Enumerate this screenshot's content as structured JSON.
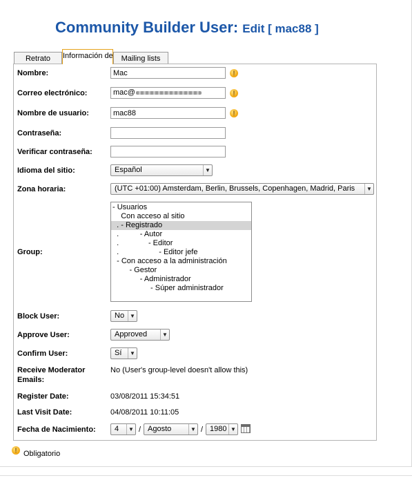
{
  "header": {
    "title": "Community Builder User:",
    "edit_label": "Edit [ mac88 ]"
  },
  "tabs": [
    {
      "label": "Retrato",
      "active": false
    },
    {
      "label": "Información de",
      "active": true
    },
    {
      "label": "Mailing lists",
      "active": false
    }
  ],
  "form": {
    "nombre_label": "Nombre:",
    "nombre_value": "Mac",
    "correo_label": "Correo electrónico:",
    "correo_value": "mac@",
    "usuario_label": "Nombre de usuario:",
    "usuario_value": "mac88",
    "contrasena_label": "Contraseña:",
    "verificar_label": "Verificar contraseña:",
    "idioma_label": "Idioma del sitio:",
    "idioma_value": "Español",
    "zona_label": "Zona horaria:",
    "zona_value": "(UTC +01:00) Amsterdam, Berlin, Brussels, Copenhagen, Madrid, Paris",
    "group_label": "Group:",
    "group_options": [
      {
        "text": "- Usuarios",
        "selected": false
      },
      {
        "text": "    Con acceso al sitio",
        "selected": false
      },
      {
        "text": "  . - Registrado",
        "selected": true
      },
      {
        "text": "  .          - Autor",
        "selected": false
      },
      {
        "text": "  .              - Editor",
        "selected": false
      },
      {
        "text": "  .                   - Editor jefe",
        "selected": false
      },
      {
        "text": "  - Con acceso a la administración",
        "selected": false
      },
      {
        "text": "        - Gestor",
        "selected": false
      },
      {
        "text": "             - Administrador",
        "selected": false
      },
      {
        "text": "                  - Súper administrador",
        "selected": false
      }
    ],
    "block_label": "Block User:",
    "block_value": "No",
    "approve_label": "Approve User:",
    "approve_value": "Approved",
    "confirm_label": "Confirm User:",
    "confirm_value": "Sí",
    "moderator_label_1": "Receive Moderator",
    "moderator_label_2": "Emails:",
    "moderator_value": "No (User's group-level doesn't allow this)",
    "register_label": "Register Date:",
    "register_value": "03/08/2011 15:34:51",
    "lastvisit_label": "Last Visit Date:",
    "lastvisit_value": "04/08/2011 10:11:05",
    "nacimiento_label": "Fecha de Nacimiento:",
    "day_value": "4",
    "month_value": "Agosto",
    "year_value": "1980",
    "date_separator": "/"
  },
  "legend": {
    "required_text": "Obligatorio"
  },
  "icons": {
    "required": "required-warning-icon",
    "calendar": "calendar-icon",
    "dropdown": "chevron-down-icon"
  },
  "colors": {
    "title": "#1c57a8",
    "required_icon": "#f0a30a",
    "active_tab_border": "#e6a21a"
  }
}
